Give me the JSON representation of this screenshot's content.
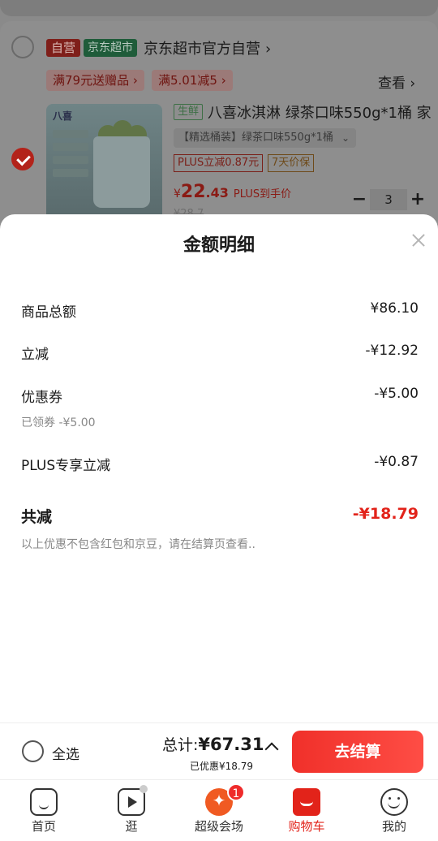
{
  "store": {
    "tag_self": "自营",
    "tag_supermarket": "京东超市",
    "name": "京东超市官方自营",
    "promos": [
      "满79元送赠品",
      "满5.01减5"
    ],
    "view": "查看"
  },
  "product": {
    "fresh_tag": "生鲜",
    "title": "八喜冰淇淋 绿茶口味550g*1桶 家",
    "image_brand": "八喜",
    "variant": "【精选桶装】绿茶口味550g*1桶",
    "plus_tag": "PLUS立减0.87元",
    "guarantee_tag": "7天价保",
    "price_symbol": "¥",
    "price_int": "22",
    "price_dec": ".43",
    "price_suffix": "PLUS到手价",
    "old_price": "¥28.7",
    "quantity": "3"
  },
  "sheet": {
    "title": "金额明细",
    "rows": [
      {
        "label": "商品总额",
        "value": "¥86.10"
      },
      {
        "label": "立减",
        "value": "-¥12.92"
      },
      {
        "label": "优惠券",
        "value": "-¥5.00",
        "note": "已领券 -¥5.00"
      },
      {
        "label": "PLUS专享立减",
        "value": "-¥0.87"
      }
    ],
    "total": {
      "label": "共减",
      "value": "-¥18.79"
    },
    "footnote": "以上优惠不包含红包和京豆，请在结算页查看.."
  },
  "checkout": {
    "select_all": "全选",
    "total_prefix": "总计:",
    "total_amount": "¥67.31",
    "saved": "已优惠¥18.79",
    "button": "去结算"
  },
  "tabs": [
    {
      "label": "首页",
      "icon": "home-icon"
    },
    {
      "label": "逛",
      "icon": "video-icon"
    },
    {
      "label": "超级会场",
      "icon": "venue-icon",
      "badge": "1"
    },
    {
      "label": "购物车",
      "icon": "cart-icon",
      "active": true
    },
    {
      "label": "我的",
      "icon": "smile-icon"
    }
  ],
  "colors": {
    "accent": "#e2231a",
    "checkout_button": "#f0302a"
  }
}
